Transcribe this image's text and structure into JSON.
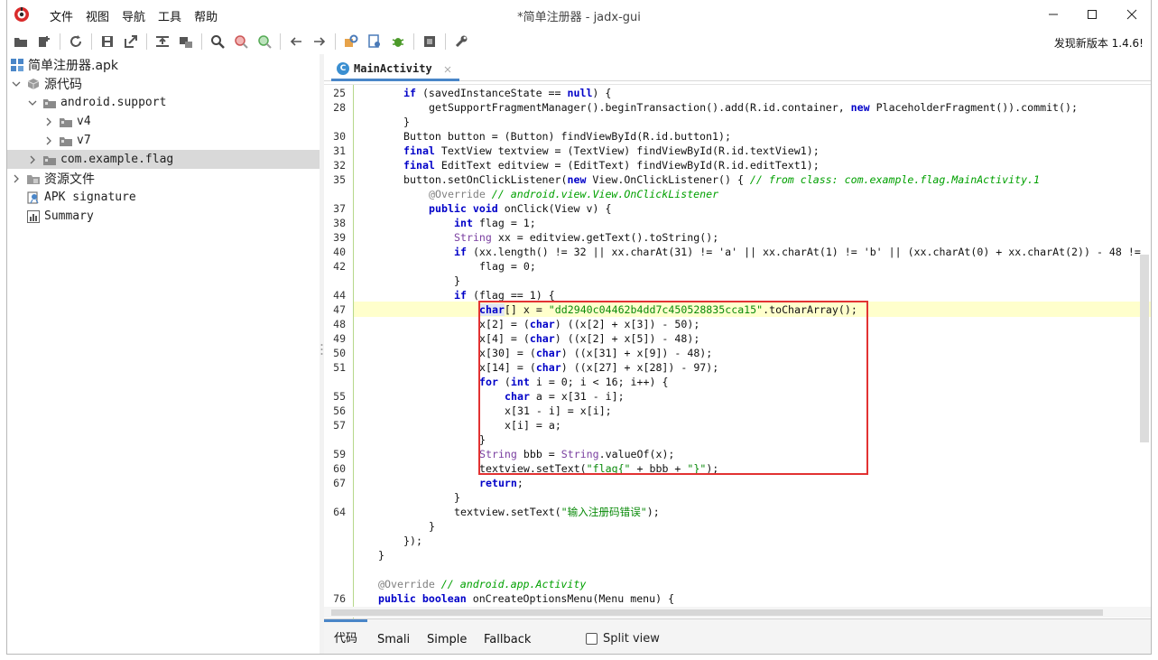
{
  "window": {
    "title": "*简单注册器 - jadx-gui",
    "menu": [
      "文件",
      "视图",
      "导航",
      "工具",
      "帮助"
    ]
  },
  "toolbar": {
    "update_text": "发现新版本 1.4.6!"
  },
  "tree": {
    "root": "简单注册器.apk",
    "source_code": "源代码",
    "android_support": "android.support",
    "v4": "v4",
    "v7": "v7",
    "com_example_flag": "com.example.flag",
    "resources": "资源文件",
    "apk_signature": "APK signature",
    "summary": "Summary"
  },
  "editor": {
    "tab_label": "MainActivity",
    "tab_icon_letter": "C",
    "line_numbers": [
      "25",
      "28",
      "",
      "30",
      "31",
      "32",
      "35",
      "",
      "37",
      "38",
      "39",
      "40",
      "42",
      "",
      "44",
      "47",
      "48",
      "49",
      "50",
      "51",
      "",
      "55",
      "56",
      "57",
      "",
      "59",
      "60",
      "67",
      "",
      "64",
      "",
      "",
      "",
      "",
      "76"
    ],
    "code": {
      "l25_if": "if",
      "l25_a": " (savedInstanceState == ",
      "l25_null": "null",
      "l25_b": ") {",
      "l28": "getSupportFragmentManager().beginTransaction().add(R.id.container, ",
      "l28_new": "new",
      "l28_b": " PlaceholderFragment()).commit();",
      "l30": "Button button = (Button) findViewById(R.id.button1);",
      "l31_final": "final",
      "l31_b": " TextView textview = (TextView) findViewById(R.id.textView1);",
      "l32_final": "final",
      "l32_b": " EditText editview = (EditText) findViewById(R.id.editText1);",
      "l35_a": "button.setOnClickListener(",
      "l35_new": "new",
      "l35_b": " View.OnClickListener() { ",
      "l35_c": "// from class: com.example.flag.MainActivity.1",
      "l36_a": "@Override",
      "l36_c": " // android.view.View.OnClickListener",
      "l37_kw": "public void",
      "l37_b": " onClick(View v) {",
      "l38_int": "int",
      "l38_b": " flag = 1;",
      "l39_t": "String",
      "l39_b": " xx = editview.getText().toString();",
      "l40_if": "if",
      "l40_b": " (xx.length() != 32 || xx.charAt(31) != 'a' || xx.charAt(1) != 'b' || (xx.charAt(0) + xx.charAt(2)) - 48 !=",
      "l42": "flag = 0;",
      "l44_if": "if",
      "l44_b": " (flag == 1) {",
      "l47_char": "char",
      "l47_a": "[] x = ",
      "l47_s": "\"dd2940c04462b4dd7c450528835cca15\"",
      "l47_b": ".toCharArray();",
      "l48_a": "x[2] = (",
      "l48_char": "char",
      "l48_b": ") ((x[2] + x[3]) - 50);",
      "l49_a": "x[4] = (",
      "l49_char": "char",
      "l49_b": ") ((x[2] + x[5]) - 48);",
      "l50_a": "x[30] = (",
      "l50_char": "char",
      "l50_b": ") ((x[31] + x[9]) - 48);",
      "l51_a": "x[14] = (",
      "l51_char": "char",
      "l51_b": ") ((x[27] + x[28]) - 97);",
      "l52_for": "for",
      "l52_a": " (",
      "l52_int": "int",
      "l52_b": " i = 0; i < 16; i++) {",
      "l55_char": "char",
      "l55_b": " a = x[31 - i];",
      "l56": "x[31 - i] = x[i];",
      "l57": "x[i] = a;",
      "close": "}",
      "l59_t": "String",
      "l59_a": " bbb = ",
      "l59_t2": "String",
      "l59_b": ".valueOf(x);",
      "l60_a": "textview.setText(",
      "l60_s1": "\"flag{\"",
      "l60_b": " + bbb + ",
      "l60_s2": "\"}\"",
      "l60_c": ");",
      "l67_return": "return",
      "l67_b": ";",
      "l64_a": "textview.setText(",
      "l64_s": "\"输入注册码错误\"",
      "l64_b": ");",
      "close_paren": "});",
      "l76_ann": "@Override",
      "l76_c": " // android.app.Activity",
      "l77_kw": "public boolean",
      "l77_b": " onCreateOptionsMenu(Menu menu) {"
    }
  },
  "bottom_tabs": {
    "code": "代码",
    "smali": "Smali",
    "simple": "Simple",
    "fallback": "Fallback",
    "split_view": "Split view"
  },
  "colors": {
    "keyword": "#0000c8",
    "string": "#0a8a0a",
    "type": "#7a3fa0",
    "comment": "#00a000",
    "highlight_line": "#ffffcc",
    "red_box": "#e23232",
    "accent": "#4a86c8"
  }
}
